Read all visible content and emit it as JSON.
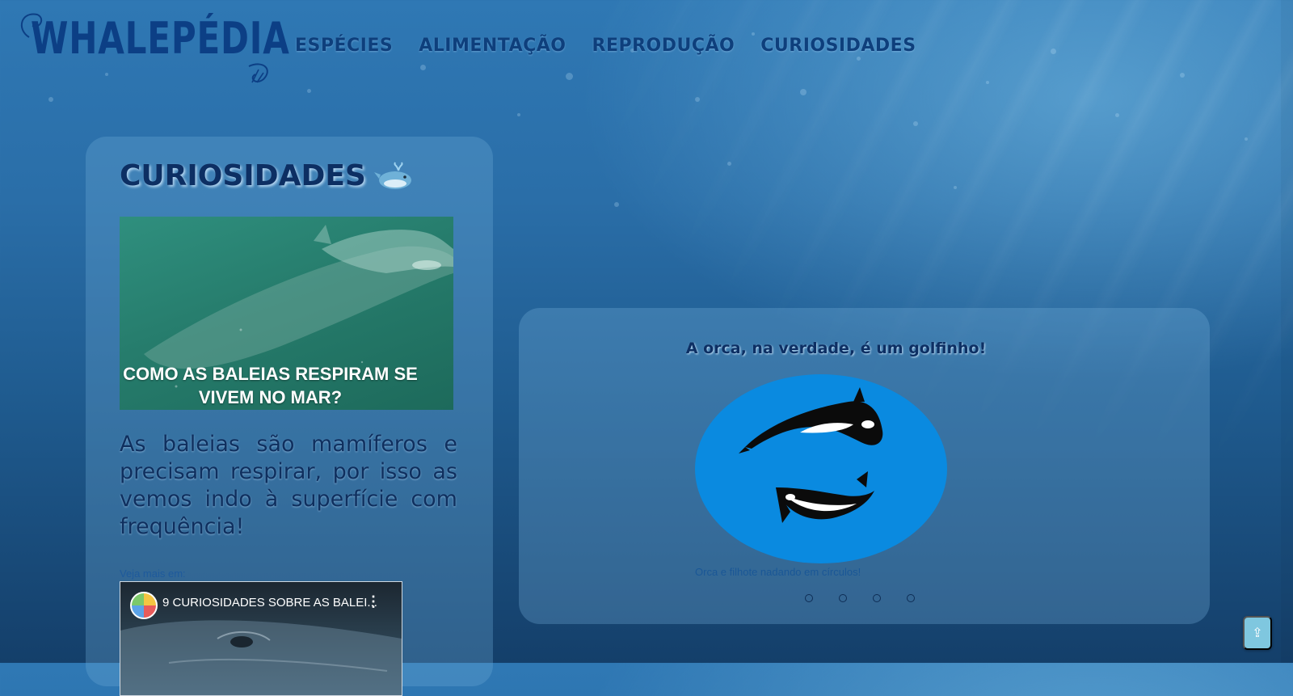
{
  "brand": {
    "logo_text": "WHALEPÉDIA"
  },
  "nav": {
    "items": [
      {
        "label": "ESPÉCIES"
      },
      {
        "label": "ALIMENTAÇÃO"
      },
      {
        "label": "REPRODUÇÃO"
      },
      {
        "label": "CURIOSIDADES"
      }
    ]
  },
  "curiosities_card": {
    "title": "CURIOSIDADES",
    "title_icon": "whale-emoji-icon",
    "thumbnail_caption": "COMO AS BALEIAS RESPIRAM SE VIVEM NO MAR?",
    "text": "As baleias são mamíferos e precisam respirar, por isso as vemos indo à superfície com frequência!",
    "see_more_label": "Veja mais em:",
    "video": {
      "title": "9 CURIOSIDADES SOBRE AS BALEI...",
      "menu_icon": "more-vert-icon"
    }
  },
  "carousel": {
    "slide_title": "A orca, na verdade, é um golfinho!",
    "image_caption": "Orca e filhote nadando em círculos!",
    "slide_count": 4
  },
  "back_to_top": {
    "label": "⇪",
    "icon": "arrow-up-icon"
  },
  "colors": {
    "nav_text": "#0e3f7c",
    "title_text": "#0d2f63",
    "orca_circle": "#0a8ae0",
    "back_to_top_bg": "#7fc7df"
  }
}
